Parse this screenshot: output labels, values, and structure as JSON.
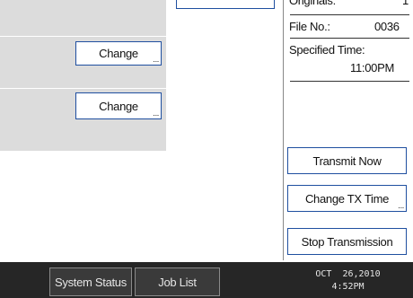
{
  "left_panel": {
    "change_buttons": [
      "Change",
      "Change"
    ]
  },
  "info": {
    "originals_label": "Originals:",
    "originals_value": "1",
    "file_no_label": "File No.:",
    "file_no_value": "0036",
    "specified_time_label": "Specified Time:",
    "specified_time_value": "11:00PM"
  },
  "actions": {
    "transmit_now": "Transmit Now",
    "change_tx_time": "Change TX Time",
    "stop_transmission": "Stop Transmission"
  },
  "status_bar": {
    "system_status": "System Status",
    "job_list": "Job List",
    "date": "OCT  26,2010",
    "time": "4:52PM"
  },
  "ellipsis": "..."
}
